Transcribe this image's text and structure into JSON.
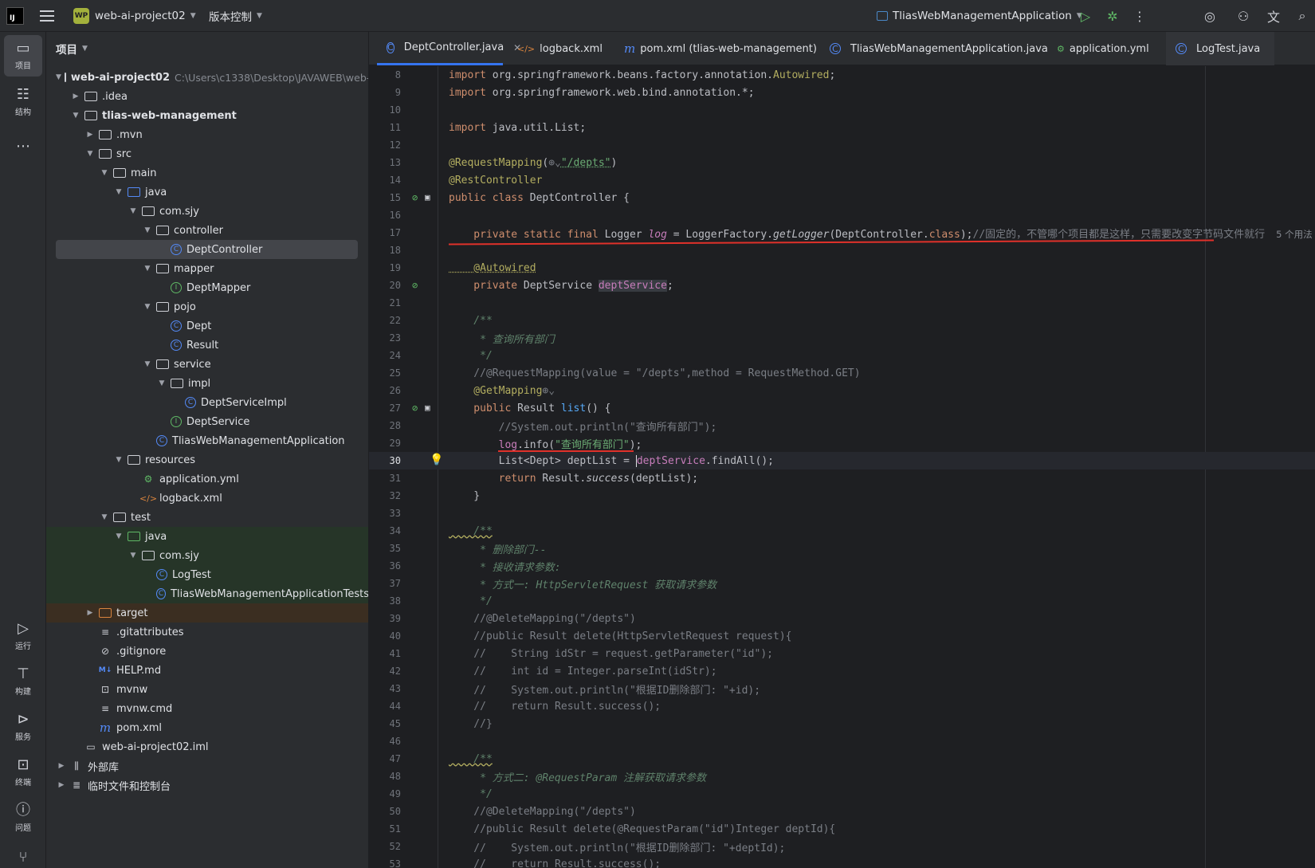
{
  "toolbar": {
    "logo": "IJ",
    "project_badge": "WP",
    "project_name": "web-ai-project02",
    "vcs_label": "版本控制",
    "run_config": "TliasWebManagementApplication"
  },
  "rail": {
    "project": "项目",
    "structure": "结构",
    "more": "⋯",
    "run": "运行",
    "build": "构建",
    "services": "服务",
    "terminal": "终端",
    "problems": "问题"
  },
  "project_panel": {
    "title": "项目",
    "tree": [
      {
        "label": "web-ai-project02",
        "hint": "C:\\Users\\c1338\\Desktop\\JAVAWEB\\web-a"
      },
      {
        "label": ".idea"
      },
      {
        "label": "tlias-web-management"
      },
      {
        "label": ".mvn"
      },
      {
        "label": "src"
      },
      {
        "label": "main"
      },
      {
        "label": "java"
      },
      {
        "label": "com.sjy"
      },
      {
        "label": "controller"
      },
      {
        "label": "DeptController"
      },
      {
        "label": "mapper"
      },
      {
        "label": "DeptMapper"
      },
      {
        "label": "pojo"
      },
      {
        "label": "Dept"
      },
      {
        "label": "Result"
      },
      {
        "label": "service"
      },
      {
        "label": "impl"
      },
      {
        "label": "DeptServiceImpl"
      },
      {
        "label": "DeptService"
      },
      {
        "label": "TliasWebManagementApplication"
      },
      {
        "label": "resources"
      },
      {
        "label": "application.yml"
      },
      {
        "label": "logback.xml"
      },
      {
        "label": "test"
      },
      {
        "label": "java"
      },
      {
        "label": "com.sjy"
      },
      {
        "label": "LogTest"
      },
      {
        "label": "TliasWebManagementApplicationTests"
      },
      {
        "label": "target"
      },
      {
        "label": ".gitattributes"
      },
      {
        "label": ".gitignore"
      },
      {
        "label": "HELP.md"
      },
      {
        "label": "mvnw"
      },
      {
        "label": "mvnw.cmd"
      },
      {
        "label": "pom.xml"
      },
      {
        "label": "web-ai-project02.iml"
      },
      {
        "label": "外部库"
      },
      {
        "label": "临时文件和控制台"
      }
    ]
  },
  "tabs": [
    {
      "label": "DeptController.java",
      "icon": "class-icon"
    },
    {
      "label": "logback.xml",
      "icon": "xml-icon"
    },
    {
      "label": "pom.xml (tlias-web-management)",
      "icon": "maven-icon"
    },
    {
      "label": "TliasWebManagementApplication.java",
      "icon": "spring-class-icon"
    },
    {
      "label": "application.yml",
      "icon": "yaml-icon"
    },
    {
      "label": "LogTest.java",
      "icon": "class-icon"
    }
  ],
  "editor": {
    "usage_hint": "5 个用法",
    "line_numbers": [
      "8",
      "9",
      "10",
      "11",
      "12",
      "13",
      "14",
      "15",
      "16",
      "17",
      "18",
      "19",
      "20",
      "21",
      "22",
      "23",
      "24",
      "25",
      "26",
      "27",
      "28",
      "29",
      "30",
      "31",
      "32",
      "33",
      "34",
      "35",
      "36",
      "37",
      "38",
      "39",
      "40",
      "41",
      "42",
      "43",
      "44",
      "45",
      "46",
      "47",
      "48",
      "49",
      "50",
      "51",
      "52",
      "53"
    ],
    "lines": {
      "l8a": "import ",
      "l8b": "org.springframework.beans.factory.annotation.",
      "l8c": "Autowired",
      "l8d": ";",
      "l9a": "import ",
      "l9b": "org.springframework.web.bind.annotation.*;",
      "l11a": "import ",
      "l11b": "java.util.List;",
      "l13a": "@RequestMapping",
      "l13b": "(",
      "l13c": "⊕⌄",
      "l13d": "\"/depts\"",
      "l13e": ")",
      "l14a": "@RestController",
      "l15a": "public class ",
      "l15b": "DeptController {",
      "l17a": "    private static final ",
      "l17b": "Logger ",
      "l17c": "log",
      "l17d": " = LoggerFactory.",
      "l17e": "getLogger",
      "l17f": "(DeptController.",
      "l17g": "class",
      "l17h": ");",
      "l17i": "//固定的，不管哪个项目都是这样，只需要改变字节码文件就行",
      "l19a": "    @Autowired",
      "l20a": "    private ",
      "l20b": "DeptService ",
      "l20c": "deptService",
      "l20d": ";",
      "l22a": "    /**",
      "l23a": "     * 查询所有部门",
      "l24a": "     */",
      "l25a": "    //@RequestMapping(value = \"/depts\",method = RequestMethod.GET)",
      "l26a": "    @GetMapping",
      "l26b": "⊕⌄",
      "l27a": "    public ",
      "l27b": "Result ",
      "l27c": "list",
      "l27d": "() {",
      "l28a": "        //System.out.println(\"查询所有部门\");",
      "l29a": "        ",
      "l29b": "log",
      "l29c": ".info(",
      "l29d": "\"查询所有部门\"",
      "l29e": ");",
      "l30a": "        List<Dept> deptList = ",
      "l30b": "deptService",
      "l30c": ".findAll();",
      "l31a": "        return ",
      "l31b": "Result.",
      "l31c": "success",
      "l31d": "(deptList);",
      "l32a": "    }",
      "l34a": "    /**",
      "l35a": "     * 删除部门--",
      "l36a": "     * 接收请求参数:",
      "l37a": "     * 方式一: HttpServletRequest 获取请求参数",
      "l38a": "     */",
      "l39a": "    //@DeleteMapping(\"/depts\")",
      "l40a": "    //public Result delete(HttpServletRequest request){",
      "l41a": "    //    String idStr = request.getParameter(\"id\");",
      "l42a": "    //    int id = Integer.parseInt(idStr);",
      "l43a": "    //    System.out.println(\"根据ID删除部门: \"+id);",
      "l44a": "    //    return Result.success();",
      "l45a": "    //}",
      "l47a": "    /**",
      "l48a": "     * 方式二: @RequestParam 注解获取请求参数",
      "l49a": "     */",
      "l50a": "    //@DeleteMapping(\"/depts\")",
      "l51a": "    //public Result delete(@RequestParam(\"id\")Integer deptId){",
      "l52a": "    //    System.out.println(\"根据ID删除部门: \"+deptId);",
      "l53a": "    //    return Result.success();"
    }
  },
  "colors": {
    "accent": "#3574f0",
    "keyword": "#cf8e6d",
    "string": "#6aab73",
    "annotation": "#b3ae60",
    "field": "#c77dbb",
    "red_annotation_mark": "#e0312a"
  }
}
